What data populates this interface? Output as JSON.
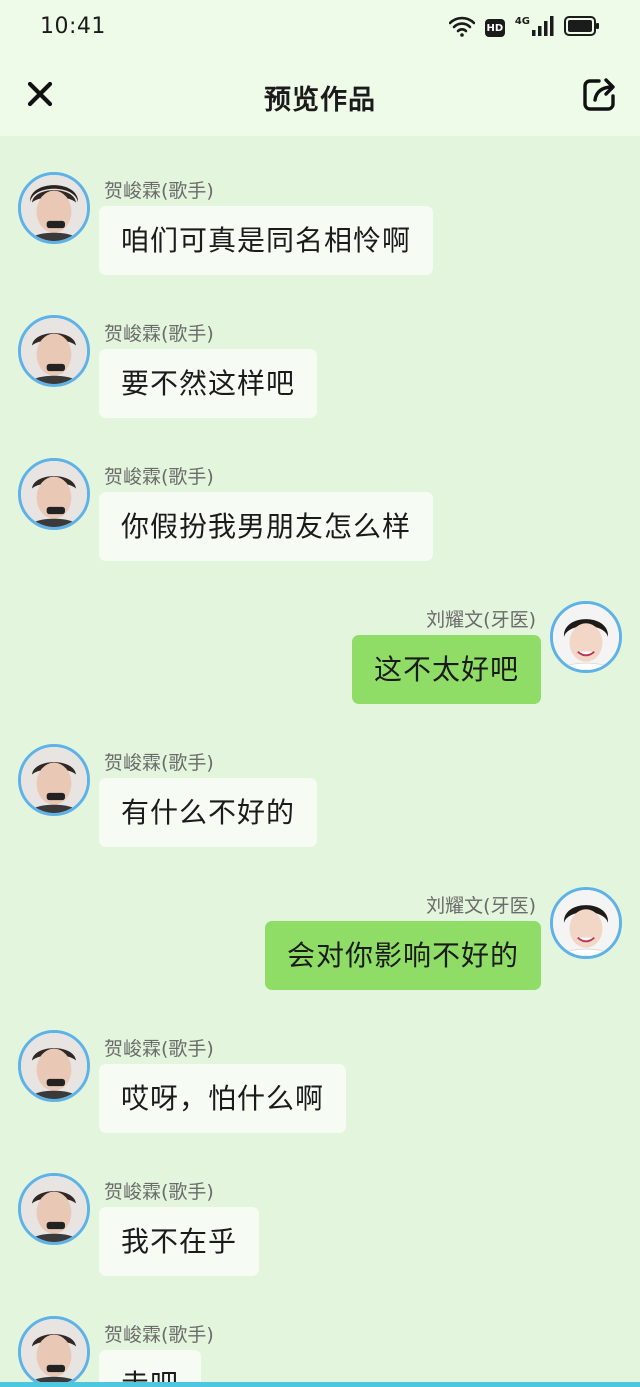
{
  "status_bar": {
    "time": "10:41",
    "network": "4G",
    "hd_badge": "HD",
    "icons": [
      "wifi-icon",
      "hd-icon",
      "signal-icon",
      "battery-icon"
    ]
  },
  "header": {
    "title": "预览作品",
    "close_icon": "close-icon",
    "share_icon": "share-icon"
  },
  "colors": {
    "background": "#e3f5dc",
    "header_bg": "#effbe9",
    "left_bubble": "#f6fcf3",
    "right_bubble": "#8fdd66",
    "avatar_ring": "#5db2e8"
  },
  "messages": [
    {
      "side": "left",
      "sender": "贺峻霖(歌手)",
      "text": "咱们可真是同名相怜啊"
    },
    {
      "side": "left",
      "sender": "贺峻霖(歌手)",
      "text": "要不然这样吧"
    },
    {
      "side": "left",
      "sender": "贺峻霖(歌手)",
      "text": "你假扮我男朋友怎么样"
    },
    {
      "side": "right",
      "sender": "刘耀文(牙医)",
      "text": "这不太好吧"
    },
    {
      "side": "left",
      "sender": "贺峻霖(歌手)",
      "text": "有什么不好的"
    },
    {
      "side": "right",
      "sender": "刘耀文(牙医)",
      "text": "会对你影响不好的"
    },
    {
      "side": "left",
      "sender": "贺峻霖(歌手)",
      "text": "哎呀，怕什么啊"
    },
    {
      "side": "left",
      "sender": "贺峻霖(歌手)",
      "text": "我不在乎"
    },
    {
      "side": "left",
      "sender": "贺峻霖(歌手)",
      "text": "走吧"
    }
  ]
}
